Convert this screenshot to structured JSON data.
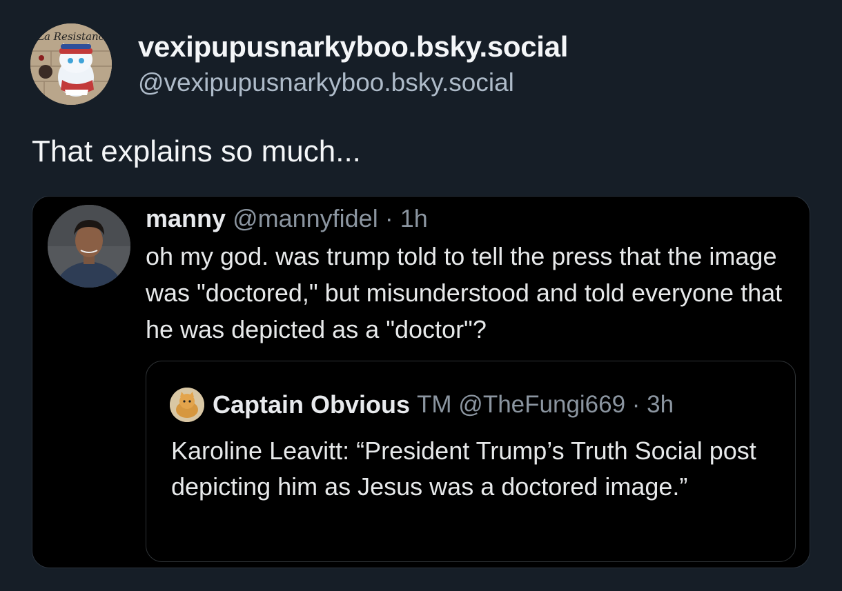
{
  "post": {
    "display_name": "vexipupusnarkyboo.bsky.social",
    "handle": "@vexipupusnarkyboo.bsky.social",
    "avatar_text": "La Resistance",
    "text": "That explains so much..."
  },
  "embedded_tweet": {
    "name": "manny",
    "meta": "@mannyfidel · 1h",
    "text": "oh my god. was trump told to tell the press that the image was \"doctored,\" but misunderstood and told everyone that he was depicted as a \"doctor\"?",
    "quoted": {
      "name": "Captain Obvious",
      "meta": "TM @TheFungi669 · 3h",
      "text": "Karoline Leavitt: “President Trump’s Truth Social post depicting him as Jesus was a doctored image.”"
    }
  },
  "colors": {
    "background": "#161e27",
    "embed_background": "#000000",
    "muted_text": "#8b95a0",
    "handle_text": "#aebbc9"
  }
}
